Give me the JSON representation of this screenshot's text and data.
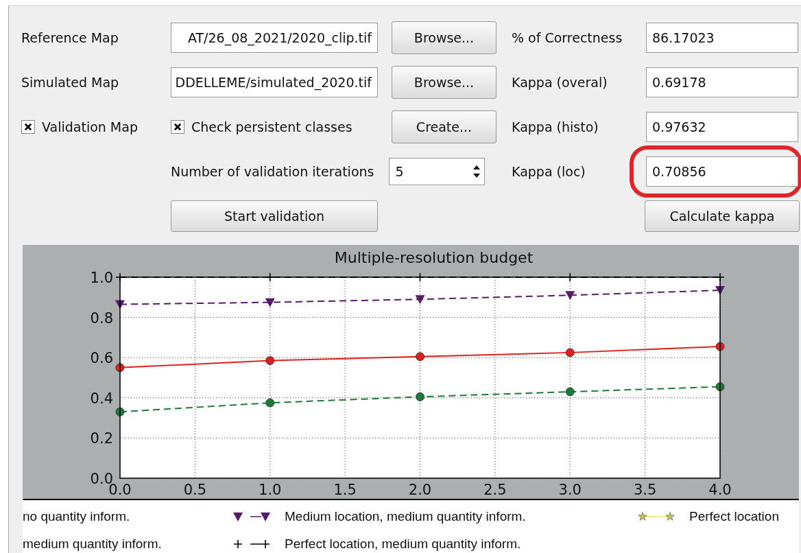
{
  "form": {
    "rows": [
      {
        "label": {
          "kind": "text",
          "text": "Reference Map"
        },
        "field": {
          "kind": "input",
          "value": "AT/26_08_2021/2020_clip.tif"
        },
        "button": "Browse...",
        "result": {
          "label": "% of Correctness",
          "value": "86.17023",
          "highlighted": false
        }
      },
      {
        "label": {
          "kind": "text",
          "text": "Simulated Map"
        },
        "field": {
          "kind": "input",
          "value": "DDELLEME/simulated_2020.tif"
        },
        "button": "Browse...",
        "result": {
          "label": "Kappa (overal)",
          "value": "0.69178",
          "highlighted": false
        }
      },
      {
        "label": {
          "kind": "checkbox",
          "text": "Validation Map",
          "checked": true
        },
        "field": {
          "kind": "checkbox",
          "text": "Check persistent classes",
          "checked": true
        },
        "button": "Create...",
        "result": {
          "label": "Kappa (histo)",
          "value": "0.97632",
          "highlighted": false
        }
      },
      {
        "field": {
          "kind": "spin",
          "text": "Number of validation iterations",
          "value": "5"
        },
        "result": {
          "label": "Kappa (loc)",
          "value": "0.70856",
          "highlighted": true
        }
      }
    ],
    "start_button": "Start validation",
    "calculate_button": "Calculate kappa"
  },
  "chart": {
    "chart_data": {
      "type": "line",
      "title": "Multiple-resolution budget",
      "x": [
        0,
        1,
        2,
        3,
        4
      ],
      "xlim": [
        0,
        4
      ],
      "ylim": [
        0,
        1
      ],
      "grid": true,
      "xticks": [
        {
          "value": 0,
          "label": "0.0"
        },
        0.5,
        {
          "value": 1,
          "label": "1.0"
        },
        1.5,
        {
          "value": 2,
          "label": "2.0"
        },
        2.5,
        {
          "value": 3,
          "label": "3.0"
        },
        3.5,
        {
          "value": 4,
          "label": "4.0"
        }
      ],
      "yticks": [
        {
          "value": 0,
          "label": "0.0"
        },
        0.2,
        0.4,
        0.6,
        0.8,
        {
          "value": 1,
          "label": "1.0"
        }
      ],
      "series": [
        {
          "name": "no quantity inform.",
          "color": "#1a7a3a",
          "line_style": "dashed",
          "marker": "circle",
          "values": [
            0.33,
            0.375,
            0.405,
            0.43,
            0.455
          ]
        },
        {
          "name": "medium quantity inform.",
          "color": "#e02020",
          "line_style": "solid",
          "marker": "circle",
          "values": [
            0.55,
            0.585,
            0.605,
            0.625,
            0.655
          ]
        },
        {
          "name": "Medium location, medium quantity inform.",
          "color": "#5a1a6a",
          "line_style": "dashed",
          "marker": "triangle",
          "values": [
            0.865,
            0.875,
            0.89,
            0.91,
            0.935
          ]
        },
        {
          "name": "Perfect location, medium quantity inform.",
          "color": "#000000",
          "line_style": "dashed",
          "marker": "plus",
          "values": [
            1,
            1,
            1,
            1,
            1
          ]
        },
        {
          "name": "Perfect location",
          "color": "#e8e860",
          "line_style": "solid",
          "marker": "star",
          "values": [
            null,
            null,
            null,
            null,
            null
          ]
        }
      ]
    },
    "legend": [
      {
        "cut": true
      },
      {
        "cut": true
      },
      {
        "cut": false
      },
      {
        "cut": false
      },
      {
        "cut": false
      }
    ]
  }
}
